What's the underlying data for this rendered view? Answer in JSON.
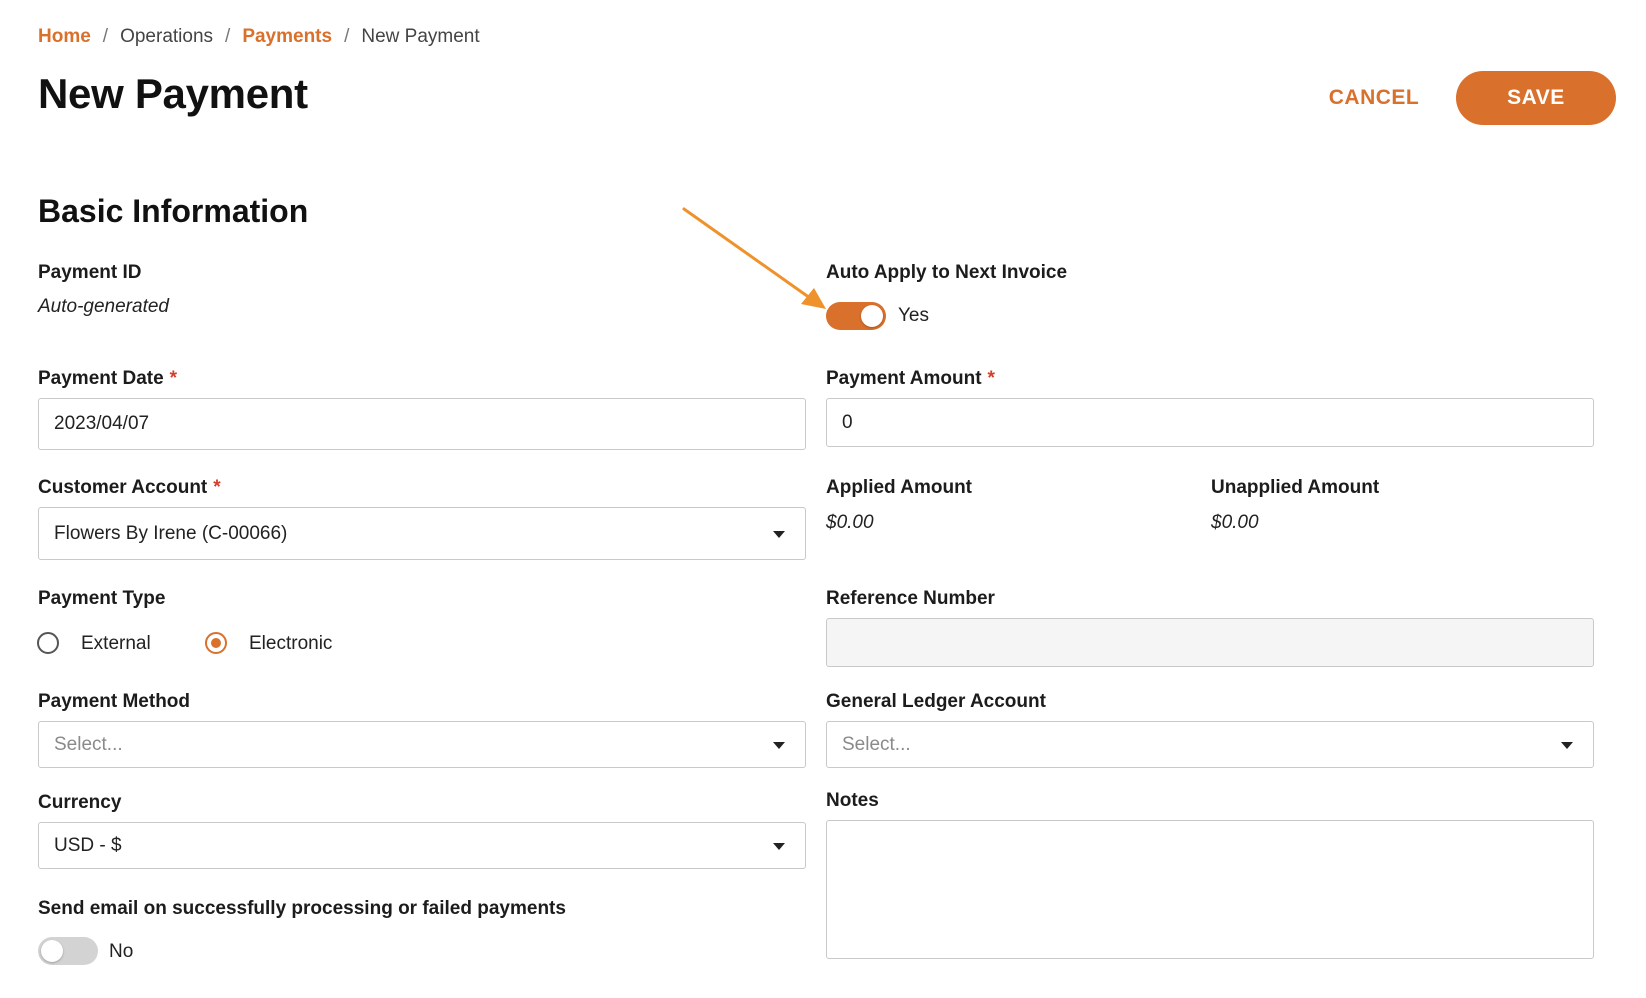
{
  "breadcrumb": {
    "home": "Home",
    "sep1": "/",
    "operations": "Operations",
    "sep2": "/",
    "payments": "Payments",
    "sep3": "/",
    "current": "New Payment"
  },
  "header": {
    "title": "New Payment",
    "cancel_label": "CANCEL",
    "save_label": "SAVE"
  },
  "section": {
    "title": "Basic Information"
  },
  "form": {
    "payment_id": {
      "label": "Payment ID",
      "value": "Auto-generated"
    },
    "auto_apply": {
      "label": "Auto Apply to Next Invoice",
      "state_label": "Yes",
      "on": true
    },
    "payment_date": {
      "label": "Payment Date",
      "required_mark": "*",
      "value": "2023/04/07"
    },
    "payment_amount": {
      "label": "Payment Amount",
      "required_mark": "*",
      "value": "0"
    },
    "customer_account": {
      "label": "Customer Account",
      "required_mark": "*",
      "value": "Flowers By Irene (C-00066)"
    },
    "applied_amount": {
      "label": "Applied Amount",
      "value": "$0.00"
    },
    "unapplied_amount": {
      "label": "Unapplied Amount",
      "value": "$0.00"
    },
    "payment_type": {
      "label": "Payment Type",
      "options": [
        {
          "label": "External",
          "checked": false
        },
        {
          "label": "Electronic",
          "checked": true
        }
      ]
    },
    "reference_number": {
      "label": "Reference Number",
      "value": ""
    },
    "payment_method": {
      "label": "Payment Method",
      "placeholder": "Select..."
    },
    "general_ledger_account": {
      "label": "General Ledger Account",
      "placeholder": "Select..."
    },
    "currency": {
      "label": "Currency",
      "value": "USD - $"
    },
    "notes": {
      "label": "Notes",
      "value": ""
    },
    "send_email": {
      "label": "Send email on successfully processing or failed payments",
      "state_label": "No",
      "on": false
    }
  },
  "colors": {
    "accent": "#d9702b",
    "required": "#d43f2a",
    "annotation_arrow": "#f0922b"
  }
}
